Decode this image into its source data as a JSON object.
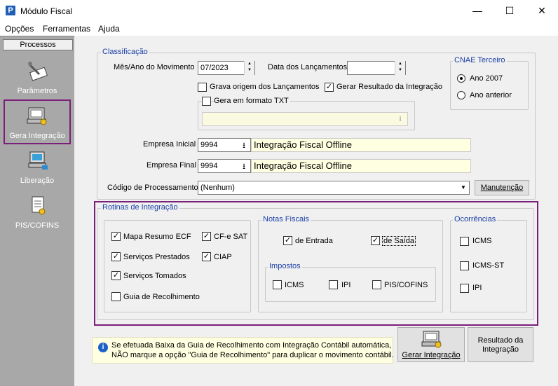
{
  "window": {
    "title": "Módulo Fiscal",
    "minimize": "—",
    "maximize": "☐",
    "close": "✕"
  },
  "menu": {
    "items": [
      "Opções",
      "Ferramentas",
      "Ajuda"
    ]
  },
  "sidebar": {
    "header": "Processos",
    "items": [
      {
        "label": "Parâmetros",
        "icon": "parameters-icon"
      },
      {
        "label": "Gera Integração",
        "icon": "computer-gear-icon"
      },
      {
        "label": "Liberação",
        "icon": "computer-release-icon"
      },
      {
        "label": "PIS/COFINS",
        "icon": "document-icon"
      }
    ]
  },
  "classificacao": {
    "legend": "Classificação",
    "mes_ano_label": "Mês/Ano do Movimento",
    "mes_ano_value": "07/2023",
    "data_lanc_label": "Data dos Lançamentos",
    "data_lanc_value": "",
    "grava_origem_label": "Grava origem dos Lançamentos",
    "grava_origem_checked": false,
    "gerar_resultado_label": "Gerar Resultado da Integração",
    "gerar_resultado_checked": true,
    "gera_txt_label": "Gera em formato TXT",
    "gera_txt_checked": false,
    "txt_path_value": "",
    "empresa_inicial_label": "Empresa Inicial",
    "empresa_inicial_code": "9994",
    "empresa_inicial_name": "Integração Fiscal Offline",
    "empresa_final_label": "Empresa Final",
    "empresa_final_code": "9994",
    "empresa_final_name": "Integração Fiscal Offline",
    "codigo_proc_label": "Código de Processamento",
    "codigo_proc_value": "(Nenhum)",
    "manutencao_label": "Manutenção"
  },
  "cnae": {
    "legend": "CNAE Terceiro",
    "options": [
      {
        "label": "Ano 2007",
        "selected": true
      },
      {
        "label": "Ano anterior",
        "selected": false
      }
    ]
  },
  "rotinas": {
    "legend": "Rotinas de Integração",
    "items": [
      {
        "label": "Mapa Resumo ECF",
        "checked": true
      },
      {
        "label": "Serviços Prestados",
        "checked": true
      },
      {
        "label": "Serviços Tomados",
        "checked": true
      },
      {
        "label": "Guia de Recolhimento",
        "checked": false
      },
      {
        "label": "CF-e SAT",
        "checked": true
      },
      {
        "label": "CIAP",
        "checked": true
      }
    ]
  },
  "notas": {
    "legend": "Notas Fiscais",
    "entrada_label": "de Entrada",
    "entrada_checked": true,
    "saida_label": "de Saída",
    "saida_checked": true,
    "impostos": {
      "legend": "Impostos",
      "items": [
        {
          "label": "ICMS",
          "checked": false
        },
        {
          "label": "IPI",
          "checked": false
        },
        {
          "label": "PIS/COFINS",
          "checked": false
        }
      ]
    }
  },
  "ocorrencias": {
    "legend": "Ocorrências",
    "items": [
      {
        "label": "ICMS",
        "checked": false
      },
      {
        "label": "ICMS-ST",
        "checked": false
      },
      {
        "label": "IPI",
        "checked": false
      }
    ]
  },
  "info": {
    "line1": "Se efetuada Baixa da Guia de Recolhimento com Integração Contábil automática,",
    "line2": "NÃO marque a opção \"Guia de Recolhimento\" para duplicar o movimento contábil."
  },
  "actions": {
    "gerar_label": "Gerar Integração",
    "resultado_line1": "Resultado da",
    "resultado_line2": "Integração"
  },
  "checkmark": "✓",
  "dropdown_arrow": "▼",
  "lookup_arrow": "⭳"
}
